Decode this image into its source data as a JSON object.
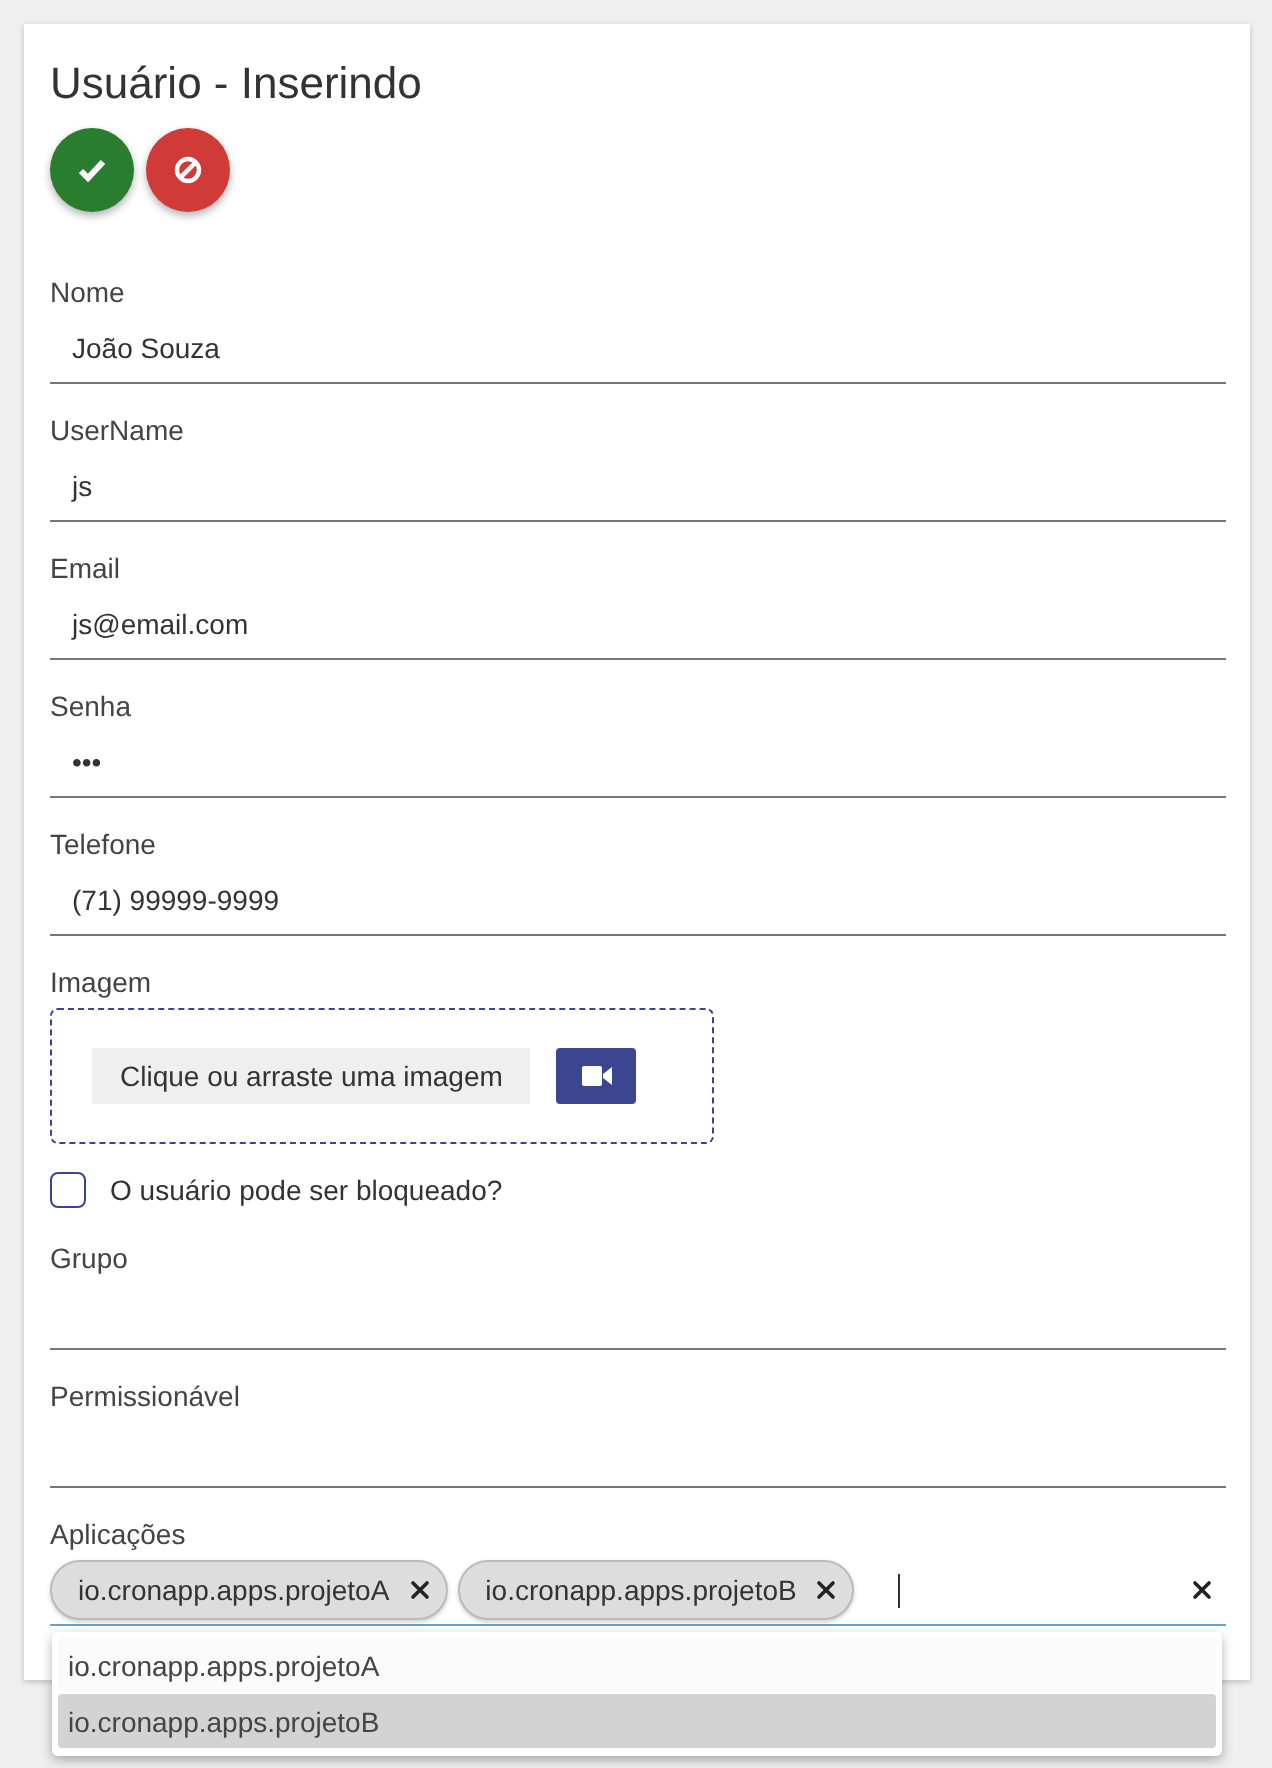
{
  "title": "Usuário - Inserindo",
  "actions": [
    {
      "kind": "save"
    },
    {
      "kind": "cancel"
    }
  ],
  "fields": [
    {
      "label": "Nome",
      "value": "João Souza"
    },
    {
      "label": "UserName",
      "value": "js"
    },
    {
      "label": "Email",
      "value": "js@email.com"
    },
    {
      "label": "Senha",
      "value": "•••"
    },
    {
      "label": "Telefone",
      "value": "(71) 99999-9999"
    }
  ],
  "image": {
    "label": "Imagem",
    "button": "Clique ou arraste uma imagem"
  },
  "checkbox": {
    "label": "O usuário pode ser bloqueado?",
    "checked": false
  },
  "selects": [
    {
      "label": "Grupo"
    },
    {
      "label": "Permissionável"
    }
  ],
  "applications": {
    "label": "Aplicações",
    "chips": [
      "io.cronapp.apps.projetoA",
      "io.cronapp.apps.projetoB"
    ],
    "options": [
      {
        "label": "io.cronapp.apps.projetoA",
        "selected": false
      },
      {
        "label": "io.cronapp.apps.projetoB",
        "selected": true
      }
    ]
  }
}
